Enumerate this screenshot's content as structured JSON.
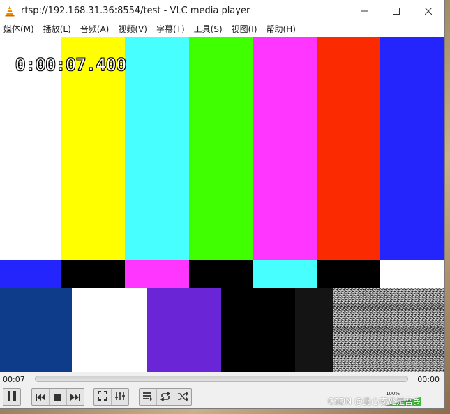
{
  "window": {
    "title": "rtsp://192.168.31.36:8554/test - VLC media player"
  },
  "menu": [
    {
      "label": "媒体(M)"
    },
    {
      "label": "播放(L)"
    },
    {
      "label": "音频(A)"
    },
    {
      "label": "视频(V)"
    },
    {
      "label": "字幕(T)"
    },
    {
      "label": "工具(S)"
    },
    {
      "label": "视图(I)"
    },
    {
      "label": "帮助(H)"
    }
  ],
  "video": {
    "overlay_timestamp": "0:00:07.400",
    "top_bars": [
      "#ffffff",
      "#ffff00",
      "#48ffff",
      "#40ff00",
      "#ff36ff",
      "#fb2a00",
      "#2424fc"
    ],
    "middle_bars": [
      "#2424fc",
      "#000000",
      "#ff36ff",
      "#000000",
      "#48ffff",
      "#000000",
      "#ffffff"
    ],
    "bottom_bars": [
      "#0f3c8a",
      "#ffffff",
      "#6a26d6",
      "#000000",
      "#141414"
    ]
  },
  "controls": {
    "elapsed": "00:07",
    "remaining": "00:00",
    "progress_fraction": 0.0,
    "volume_label": "100%",
    "volume_fraction": 1.0
  },
  "watermark": {
    "text": "CSDN @此心安处是吾乡"
  },
  "icons": {
    "app": "vlc-cone-icon",
    "minimize": "minimize-icon",
    "maximize": "maximize-icon",
    "close": "close-icon",
    "pause": "pause-icon",
    "previous": "previous-icon",
    "stop": "stop-icon",
    "next": "next-icon",
    "fullscreen": "fullscreen-icon",
    "extended": "extended-settings-icon",
    "playlist": "playlist-icon",
    "loop": "loop-icon",
    "shuffle": "shuffle-icon"
  },
  "colors": {
    "accent_volume": "#3cc43c",
    "vlc_orange": "#f08a00"
  }
}
